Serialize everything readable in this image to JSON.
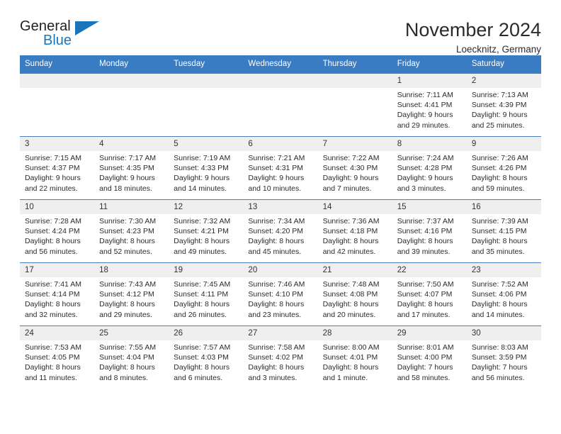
{
  "brand": {
    "name_part1": "General",
    "name_part2": "Blue",
    "accent_color": "#1b75bb"
  },
  "header": {
    "title": "November 2024",
    "subtitle": "Loecknitz, Germany"
  },
  "calendar": {
    "header_bg": "#3a7cc4",
    "daynum_bg": "#efefef",
    "weekdays": [
      "Sunday",
      "Monday",
      "Tuesday",
      "Wednesday",
      "Thursday",
      "Friday",
      "Saturday"
    ],
    "weeks": [
      [
        {
          "day": "",
          "empty": true
        },
        {
          "day": "",
          "empty": true
        },
        {
          "day": "",
          "empty": true
        },
        {
          "day": "",
          "empty": true
        },
        {
          "day": "",
          "empty": true
        },
        {
          "day": "1",
          "sunrise": "Sunrise: 7:11 AM",
          "sunset": "Sunset: 4:41 PM",
          "daylight_line1": "Daylight: 9 hours",
          "daylight_line2": "and 29 minutes."
        },
        {
          "day": "2",
          "sunrise": "Sunrise: 7:13 AM",
          "sunset": "Sunset: 4:39 PM",
          "daylight_line1": "Daylight: 9 hours",
          "daylight_line2": "and 25 minutes."
        }
      ],
      [
        {
          "day": "3",
          "sunrise": "Sunrise: 7:15 AM",
          "sunset": "Sunset: 4:37 PM",
          "daylight_line1": "Daylight: 9 hours",
          "daylight_line2": "and 22 minutes."
        },
        {
          "day": "4",
          "sunrise": "Sunrise: 7:17 AM",
          "sunset": "Sunset: 4:35 PM",
          "daylight_line1": "Daylight: 9 hours",
          "daylight_line2": "and 18 minutes."
        },
        {
          "day": "5",
          "sunrise": "Sunrise: 7:19 AM",
          "sunset": "Sunset: 4:33 PM",
          "daylight_line1": "Daylight: 9 hours",
          "daylight_line2": "and 14 minutes."
        },
        {
          "day": "6",
          "sunrise": "Sunrise: 7:21 AM",
          "sunset": "Sunset: 4:31 PM",
          "daylight_line1": "Daylight: 9 hours",
          "daylight_line2": "and 10 minutes."
        },
        {
          "day": "7",
          "sunrise": "Sunrise: 7:22 AM",
          "sunset": "Sunset: 4:30 PM",
          "daylight_line1": "Daylight: 9 hours",
          "daylight_line2": "and 7 minutes."
        },
        {
          "day": "8",
          "sunrise": "Sunrise: 7:24 AM",
          "sunset": "Sunset: 4:28 PM",
          "daylight_line1": "Daylight: 9 hours",
          "daylight_line2": "and 3 minutes."
        },
        {
          "day": "9",
          "sunrise": "Sunrise: 7:26 AM",
          "sunset": "Sunset: 4:26 PM",
          "daylight_line1": "Daylight: 8 hours",
          "daylight_line2": "and 59 minutes."
        }
      ],
      [
        {
          "day": "10",
          "sunrise": "Sunrise: 7:28 AM",
          "sunset": "Sunset: 4:24 PM",
          "daylight_line1": "Daylight: 8 hours",
          "daylight_line2": "and 56 minutes."
        },
        {
          "day": "11",
          "sunrise": "Sunrise: 7:30 AM",
          "sunset": "Sunset: 4:23 PM",
          "daylight_line1": "Daylight: 8 hours",
          "daylight_line2": "and 52 minutes."
        },
        {
          "day": "12",
          "sunrise": "Sunrise: 7:32 AM",
          "sunset": "Sunset: 4:21 PM",
          "daylight_line1": "Daylight: 8 hours",
          "daylight_line2": "and 49 minutes."
        },
        {
          "day": "13",
          "sunrise": "Sunrise: 7:34 AM",
          "sunset": "Sunset: 4:20 PM",
          "daylight_line1": "Daylight: 8 hours",
          "daylight_line2": "and 45 minutes."
        },
        {
          "day": "14",
          "sunrise": "Sunrise: 7:36 AM",
          "sunset": "Sunset: 4:18 PM",
          "daylight_line1": "Daylight: 8 hours",
          "daylight_line2": "and 42 minutes."
        },
        {
          "day": "15",
          "sunrise": "Sunrise: 7:37 AM",
          "sunset": "Sunset: 4:16 PM",
          "daylight_line1": "Daylight: 8 hours",
          "daylight_line2": "and 39 minutes."
        },
        {
          "day": "16",
          "sunrise": "Sunrise: 7:39 AM",
          "sunset": "Sunset: 4:15 PM",
          "daylight_line1": "Daylight: 8 hours",
          "daylight_line2": "and 35 minutes."
        }
      ],
      [
        {
          "day": "17",
          "sunrise": "Sunrise: 7:41 AM",
          "sunset": "Sunset: 4:14 PM",
          "daylight_line1": "Daylight: 8 hours",
          "daylight_line2": "and 32 minutes."
        },
        {
          "day": "18",
          "sunrise": "Sunrise: 7:43 AM",
          "sunset": "Sunset: 4:12 PM",
          "daylight_line1": "Daylight: 8 hours",
          "daylight_line2": "and 29 minutes."
        },
        {
          "day": "19",
          "sunrise": "Sunrise: 7:45 AM",
          "sunset": "Sunset: 4:11 PM",
          "daylight_line1": "Daylight: 8 hours",
          "daylight_line2": "and 26 minutes."
        },
        {
          "day": "20",
          "sunrise": "Sunrise: 7:46 AM",
          "sunset": "Sunset: 4:10 PM",
          "daylight_line1": "Daylight: 8 hours",
          "daylight_line2": "and 23 minutes."
        },
        {
          "day": "21",
          "sunrise": "Sunrise: 7:48 AM",
          "sunset": "Sunset: 4:08 PM",
          "daylight_line1": "Daylight: 8 hours",
          "daylight_line2": "and 20 minutes."
        },
        {
          "day": "22",
          "sunrise": "Sunrise: 7:50 AM",
          "sunset": "Sunset: 4:07 PM",
          "daylight_line1": "Daylight: 8 hours",
          "daylight_line2": "and 17 minutes."
        },
        {
          "day": "23",
          "sunrise": "Sunrise: 7:52 AM",
          "sunset": "Sunset: 4:06 PM",
          "daylight_line1": "Daylight: 8 hours",
          "daylight_line2": "and 14 minutes."
        }
      ],
      [
        {
          "day": "24",
          "sunrise": "Sunrise: 7:53 AM",
          "sunset": "Sunset: 4:05 PM",
          "daylight_line1": "Daylight: 8 hours",
          "daylight_line2": "and 11 minutes."
        },
        {
          "day": "25",
          "sunrise": "Sunrise: 7:55 AM",
          "sunset": "Sunset: 4:04 PM",
          "daylight_line1": "Daylight: 8 hours",
          "daylight_line2": "and 8 minutes."
        },
        {
          "day": "26",
          "sunrise": "Sunrise: 7:57 AM",
          "sunset": "Sunset: 4:03 PM",
          "daylight_line1": "Daylight: 8 hours",
          "daylight_line2": "and 6 minutes."
        },
        {
          "day": "27",
          "sunrise": "Sunrise: 7:58 AM",
          "sunset": "Sunset: 4:02 PM",
          "daylight_line1": "Daylight: 8 hours",
          "daylight_line2": "and 3 minutes."
        },
        {
          "day": "28",
          "sunrise": "Sunrise: 8:00 AM",
          "sunset": "Sunset: 4:01 PM",
          "daylight_line1": "Daylight: 8 hours",
          "daylight_line2": "and 1 minute."
        },
        {
          "day": "29",
          "sunrise": "Sunrise: 8:01 AM",
          "sunset": "Sunset: 4:00 PM",
          "daylight_line1": "Daylight: 7 hours",
          "daylight_line2": "and 58 minutes."
        },
        {
          "day": "30",
          "sunrise": "Sunrise: 8:03 AM",
          "sunset": "Sunset: 3:59 PM",
          "daylight_line1": "Daylight: 7 hours",
          "daylight_line2": "and 56 minutes."
        }
      ]
    ]
  }
}
